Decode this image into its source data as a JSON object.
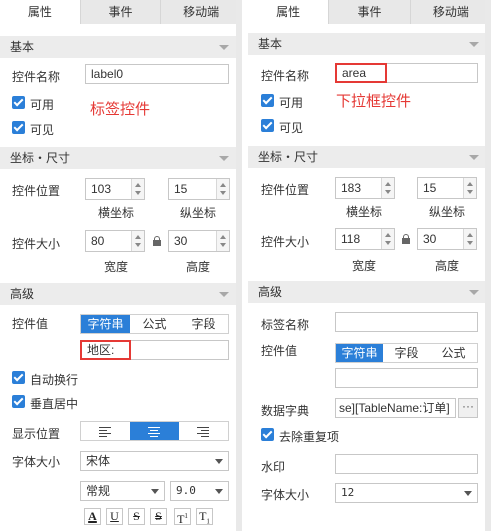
{
  "left": {
    "tabs": [
      "属性",
      "事件",
      "移动端"
    ],
    "basic": {
      "title": "基本",
      "name_label": "控件名称",
      "name_value": "label0",
      "available_label": "可用",
      "visible_label": "可见",
      "annotation": "标签控件"
    },
    "coords": {
      "title": "坐标・尺寸",
      "pos_label": "控件位置",
      "x": "103",
      "y": "15",
      "x_label": "横坐标",
      "y_label": "纵坐标",
      "size_label": "控件大小",
      "width": "80",
      "height": "30",
      "width_label": "宽度",
      "height_label": "高度"
    },
    "advanced": {
      "title": "高级",
      "value_label": "控件值",
      "value_options": [
        "字符串",
        "公式",
        "字段"
      ],
      "value_text": "地区:",
      "auto_wrap_label": "自动换行",
      "vcenter_label": "垂直居中",
      "display_pos_label": "显示位置",
      "font_size_label": "字体大小",
      "font_family": "宋体",
      "font_style": "常规",
      "font_size": "9.0",
      "format_buttons": [
        "A",
        "U",
        "S",
        "S",
        "T",
        "T"
      ],
      "format_sub": [
        "",
        "",
        "",
        "",
        "1",
        "1"
      ]
    }
  },
  "right": {
    "tabs": [
      "属性",
      "事件",
      "移动端"
    ],
    "basic": {
      "title": "基本",
      "name_label": "控件名称",
      "name_value": "area",
      "available_label": "可用",
      "visible_label": "可见",
      "annotation": "下拉框控件"
    },
    "coords": {
      "title": "坐标・尺寸",
      "pos_label": "控件位置",
      "x": "183",
      "y": "15",
      "x_label": "横坐标",
      "y_label": "纵坐标",
      "size_label": "控件大小",
      "width": "118",
      "height": "30",
      "width_label": "宽度",
      "height_label": "高度"
    },
    "advanced": {
      "title": "高级",
      "tag_name_label": "标签名称",
      "value_label": "控件值",
      "value_options": [
        "字符串",
        "字段",
        "公式"
      ],
      "dict_label": "数据字典",
      "dict_value": "se][TableName:订单]",
      "dict_more": "···",
      "dedupe_label": "去除重复项",
      "watermark_label": "水印",
      "font_size_label": "字体大小",
      "font_size": "12"
    }
  },
  "colors": {
    "accent": "#2b7fd8",
    "annotation_red": "#e53935",
    "section_bg": "#ececec",
    "tab_bar_bg": "#e8e8e8"
  }
}
